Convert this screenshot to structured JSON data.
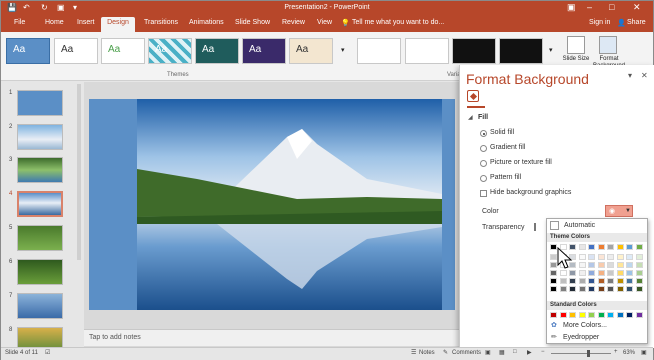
{
  "app": {
    "title": "Presentation2 - PowerPoint",
    "user": "Sign in",
    "share": "Share",
    "colors": {
      "accent": "#b7472a",
      "pane_title": "#b7472a"
    }
  },
  "tabs": [
    {
      "label": "File"
    },
    {
      "label": "Home"
    },
    {
      "label": "Insert"
    },
    {
      "label": "Design"
    },
    {
      "label": "Transitions"
    },
    {
      "label": "Animations"
    },
    {
      "label": "Slide Show"
    },
    {
      "label": "Review"
    },
    {
      "label": "View"
    }
  ],
  "tell_me": "Tell me what you want to do...",
  "ribbon": {
    "themes_group": "Themes",
    "variants_group": "Varia",
    "theme_text": "Aa",
    "slide_size": "Slide Size",
    "format_background": "Format Background"
  },
  "thumbnails": [
    {
      "num": "1"
    },
    {
      "num": "2"
    },
    {
      "num": "3"
    },
    {
      "num": "4"
    },
    {
      "num": "5"
    },
    {
      "num": "6"
    },
    {
      "num": "7"
    },
    {
      "num": "8"
    }
  ],
  "notes_placeholder": "Tap to add notes",
  "pane": {
    "title": "Format Background",
    "section": "Fill",
    "options": [
      {
        "label": "Solid fill",
        "selected": true
      },
      {
        "label": "Gradient fill",
        "selected": false
      },
      {
        "label": "Picture or texture fill",
        "selected": false
      },
      {
        "label": "Pattern fill",
        "selected": false
      }
    ],
    "hide_graphics": "Hide background graphics",
    "color_label": "Color",
    "transparency_label": "Transparency"
  },
  "palette": {
    "automatic": "Automatic",
    "theme_colors": "Theme Colors",
    "standard_colors": "Standard Colors",
    "more_colors": "More Colors...",
    "eyedropper": "Eyedropper",
    "theme_base": [
      "#000000",
      "#ffffff",
      "#44546a",
      "#e7e6e6",
      "#4472c4",
      "#ed7d31",
      "#a5a5a5",
      "#ffc000",
      "#5b9bd5",
      "#70ad47"
    ],
    "standard": [
      "#c00000",
      "#ff0000",
      "#ffc000",
      "#ffff00",
      "#92d050",
      "#00b050",
      "#00b0f0",
      "#0070c0",
      "#002060",
      "#7030a0"
    ]
  },
  "status": {
    "slide_info": "Slide 4 of 11",
    "notes": "Notes",
    "comments": "Comments",
    "zoom": "63%"
  }
}
